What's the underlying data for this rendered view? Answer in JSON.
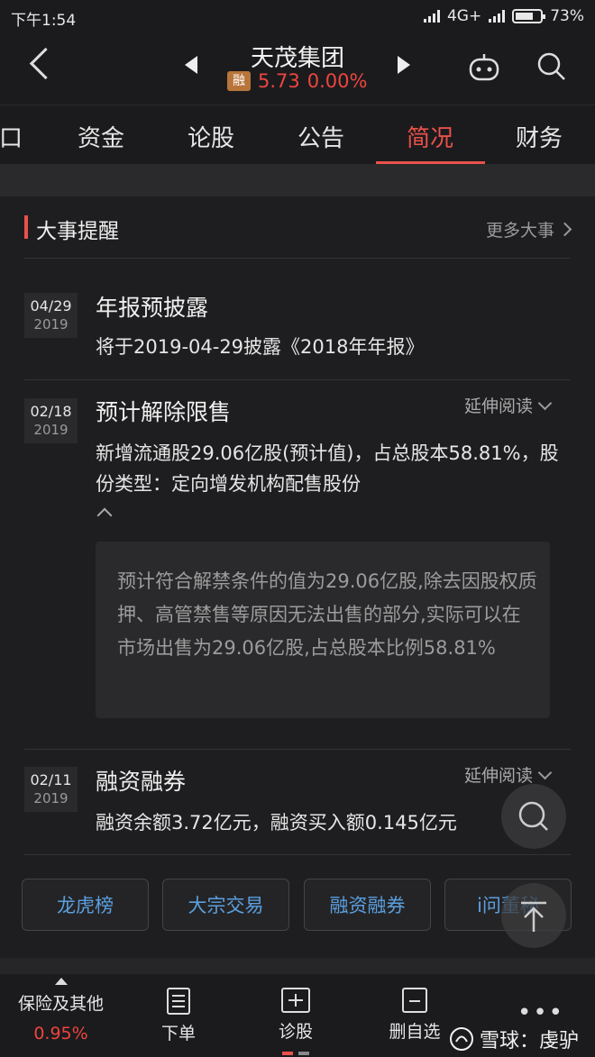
{
  "status_bar": {
    "time": "下午1:54",
    "network": "4G+",
    "battery": "73%"
  },
  "header": {
    "stock_name": "天茂集团",
    "margin_badge": "融",
    "price": "5.73",
    "change": "0.00%"
  },
  "tabs": [
    {
      "label": "口"
    },
    {
      "label": "资金"
    },
    {
      "label": "论股"
    },
    {
      "label": "公告"
    },
    {
      "label": "简况",
      "active": true
    },
    {
      "label": "财务"
    }
  ],
  "section": {
    "title": "大事提醒",
    "more_label": "更多大事"
  },
  "events": [
    {
      "month_day": "04/29",
      "year": "2019",
      "title": "年报预披露",
      "desc": "将于2019-04-29披露《2018年年报》"
    },
    {
      "month_day": "02/18",
      "year": "2019",
      "title": "预计解除限售",
      "extend_label": "延伸阅读",
      "desc": "新增流通股29.06亿股(预计值)，占总股本58.81%，股份类型：定向增发机构配售股份",
      "detail": "预计符合解禁条件的值为29.06亿股,除去因股权质押、高管禁售等原因无法出售的部分,实际可以在市场出售为29.06亿股,占总股本比例58.81%"
    },
    {
      "month_day": "02/11",
      "year": "2019",
      "title": "融资融券",
      "extend_label": "延伸阅读",
      "desc": "融资余额3.72亿元，融资买入额0.145亿元"
    }
  ],
  "quick_buttons": [
    {
      "label": "龙虎榜"
    },
    {
      "label": "大宗交易"
    },
    {
      "label": "融资融券"
    },
    {
      "label": "i问董秘"
    }
  ],
  "bottom_nav": {
    "left": {
      "label": "保险及其他",
      "change": "0.95%"
    },
    "items": [
      {
        "label": "下单"
      },
      {
        "label": "诊股"
      },
      {
        "label": "删自选"
      }
    ],
    "watermark": "雪球：虔驴"
  },
  "colors": {
    "accent": "#e9514b",
    "link": "#5b9fe0",
    "background": "#1e1e20"
  }
}
